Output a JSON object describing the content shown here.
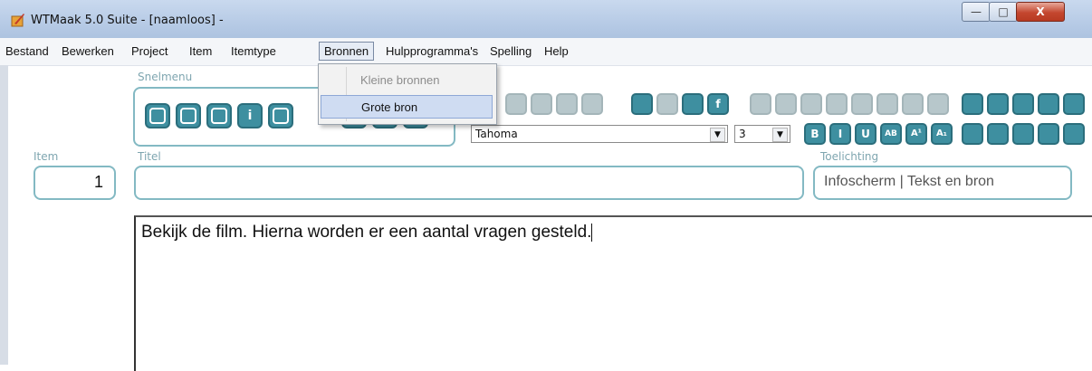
{
  "window": {
    "title": "WTMaak 5.0 Suite - [naamloos] -",
    "minimize_glyph": "—",
    "maximize_glyph": "□",
    "close_glyph": "X"
  },
  "menubar": {
    "items": [
      "Bestand",
      "Bewerken",
      "Project",
      "Item",
      "Itemtype",
      "Bronnen",
      "Hulpprogramma's",
      "Spelling",
      "Help"
    ],
    "open_menu": "Bronnen"
  },
  "dropdown": {
    "items": [
      {
        "label": "Kleine bronnen",
        "state": "disabled"
      },
      {
        "label": "Grote bron",
        "state": "highlighted"
      }
    ]
  },
  "snelmenu": {
    "caption": "Snelmenu",
    "buttons": [
      "new-icon",
      "open-icon",
      "save-icon",
      "info-icon",
      "spellcheck-icon",
      "tool-icon",
      "tool-icon",
      "tool-icon"
    ]
  },
  "format": {
    "font": "Tahoma",
    "size": "3",
    "style_buttons": [
      "B",
      "I",
      "U",
      "AB",
      "A¹",
      "A₁"
    ]
  },
  "fields": {
    "item_caption": "Item",
    "item_value": "1",
    "titel_caption": "Titel",
    "titel_value": "",
    "toelichting_caption": "Toelichting",
    "toelichting_value": "Infoscherm | Tekst en bron"
  },
  "editor": {
    "text": "Bekijk de film. Hierna worden er een aantal vragen gesteld."
  }
}
